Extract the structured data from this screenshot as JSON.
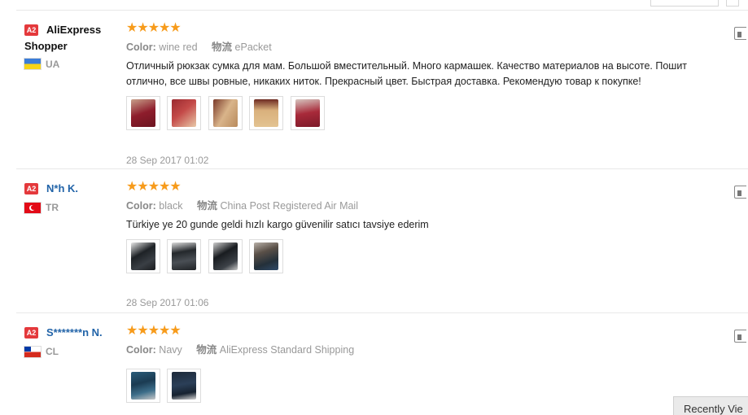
{
  "reviews": [
    {
      "badge": "A2",
      "name": "AliExpress Shopper",
      "country": "UA",
      "flag": "ua",
      "stars": 5,
      "color_label": "Color:",
      "color_value": "wine red",
      "shipping_label": "物流",
      "shipping_value": "ePacket",
      "text": "Отличный рюкзак сумка для мам. Большой вместительный. Много кармашек. Качество материалов на высоте. Пошит отлично, все швы ровные, никаких ниток. Прекрасный цвет. Быстрая доставка. Рекомендую товар к покупке!",
      "thumbs": 5,
      "date": "28 Sep 2017 01:02"
    },
    {
      "badge": "A2",
      "name": "N*h K.",
      "country": "TR",
      "flag": "tr",
      "stars": 5,
      "color_label": "Color:",
      "color_value": "black",
      "shipping_label": "物流",
      "shipping_value": "China Post Registered Air Mail",
      "text": "Türkiye ye 20 gunde geldi hızlı kargo güvenilir satıcı tavsiye ederim",
      "thumbs": 4,
      "date": "28 Sep 2017 01:06"
    },
    {
      "badge": "A2",
      "name": "S*******n N.",
      "country": "CL",
      "flag": "cl",
      "stars": 5,
      "color_label": "Color:",
      "color_value": "Navy",
      "shipping_label": "物流",
      "shipping_value": "AliExpress Standard Shipping",
      "text": "",
      "thumbs": 2,
      "date": ""
    }
  ],
  "recently_viewed_label": "Recently Vie",
  "colors": {
    "star": "#f79b1b",
    "badge": "#e4393c",
    "name_link": "#2163a8"
  }
}
